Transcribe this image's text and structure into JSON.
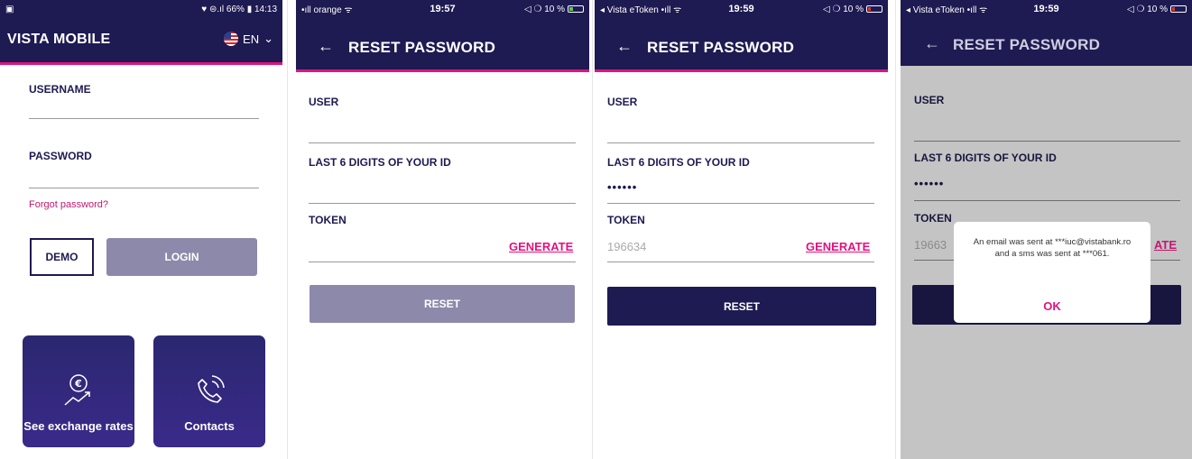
{
  "screen1": {
    "status": {
      "left": "▣",
      "right": "♥ ⊜.ıl 66% ▮ 14:13"
    },
    "app_title": "VISTA MOBILE",
    "language": "EN",
    "username_label": "USERNAME",
    "password_label": "PASSWORD",
    "forgot_link": "Forgot password?",
    "demo_button": "DEMO",
    "login_button": "LOGIN",
    "tile_exchange": "See exchange rates",
    "tile_contacts": "Contacts"
  },
  "screen2": {
    "status": {
      "carrier": "•ıll orange ᯤ",
      "time": "19:57",
      "right": "◁ ❍ 10 %"
    },
    "title": "RESET PASSWORD",
    "user_label": "USER",
    "id_label": "LAST 6 DIGITS OF YOUR ID",
    "token_label": "TOKEN",
    "generate": "GENERATE",
    "reset_button": "RESET"
  },
  "screen3": {
    "status": {
      "carrier": "◂ Vista eToken •ıll ᯤ",
      "time": "19:59",
      "right": "◁ ❍ 10 %"
    },
    "title": "RESET PASSWORD",
    "user_label": "USER",
    "id_label": "LAST 6 DIGITS OF YOUR ID",
    "id_value": "••••••",
    "token_label": "TOKEN",
    "token_value": "196634",
    "generate": "GENERATE",
    "reset_button": "RESET"
  },
  "screen4": {
    "status": {
      "carrier": "◂ Vista eToken •ıll ᯤ",
      "time": "19:59",
      "right": "◁ ❍ 10 %"
    },
    "title": "RESET PASSWORD",
    "user_label": "USER",
    "id_label": "LAST 6 DIGITS OF YOUR ID",
    "id_value": "••••••",
    "token_label": "TOKEN",
    "token_value": "19663",
    "generate": "ATE",
    "dialog_message": "An email was sent at ***iuc@vistabank.ro and a sms was sent at ***061.",
    "dialog_ok": "OK"
  },
  "colors": {
    "header": "#1e1a52",
    "accent": "#e0127f",
    "disabled_button": "#8d89aa",
    "overlay": "#c4c4c4"
  },
  "icons": [
    "euro-exchange-icon",
    "phone-icon",
    "back-arrow-icon",
    "flag-us-icon",
    "chevron-down-icon",
    "battery-icon"
  ]
}
